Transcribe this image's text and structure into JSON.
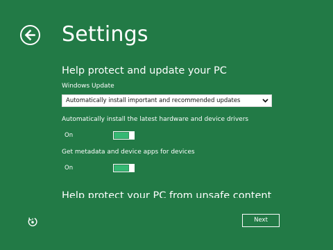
{
  "header": {
    "title": "Settings",
    "back_icon": "back-arrow-icon"
  },
  "sections": [
    {
      "heading": "Help protect and update your PC",
      "windows_update": {
        "label": "Windows Update",
        "selected": "Automatically install important and recommended updates",
        "chevron_icon": "chevron-down-icon"
      },
      "toggles": [
        {
          "label": "Automatically install the latest hardware and device drivers",
          "state": "On",
          "on": true
        },
        {
          "label": "Get metadata and device apps for devices",
          "state": "On",
          "on": true
        }
      ]
    },
    {
      "heading": "Help protect your PC from unsafe content"
    }
  ],
  "footer": {
    "ease_of_access_icon": "ease-of-access-icon",
    "next_label": "Next"
  },
  "colors": {
    "background": "#227a46",
    "toggle_fill": "#35b873",
    "text": "#ffffff"
  }
}
